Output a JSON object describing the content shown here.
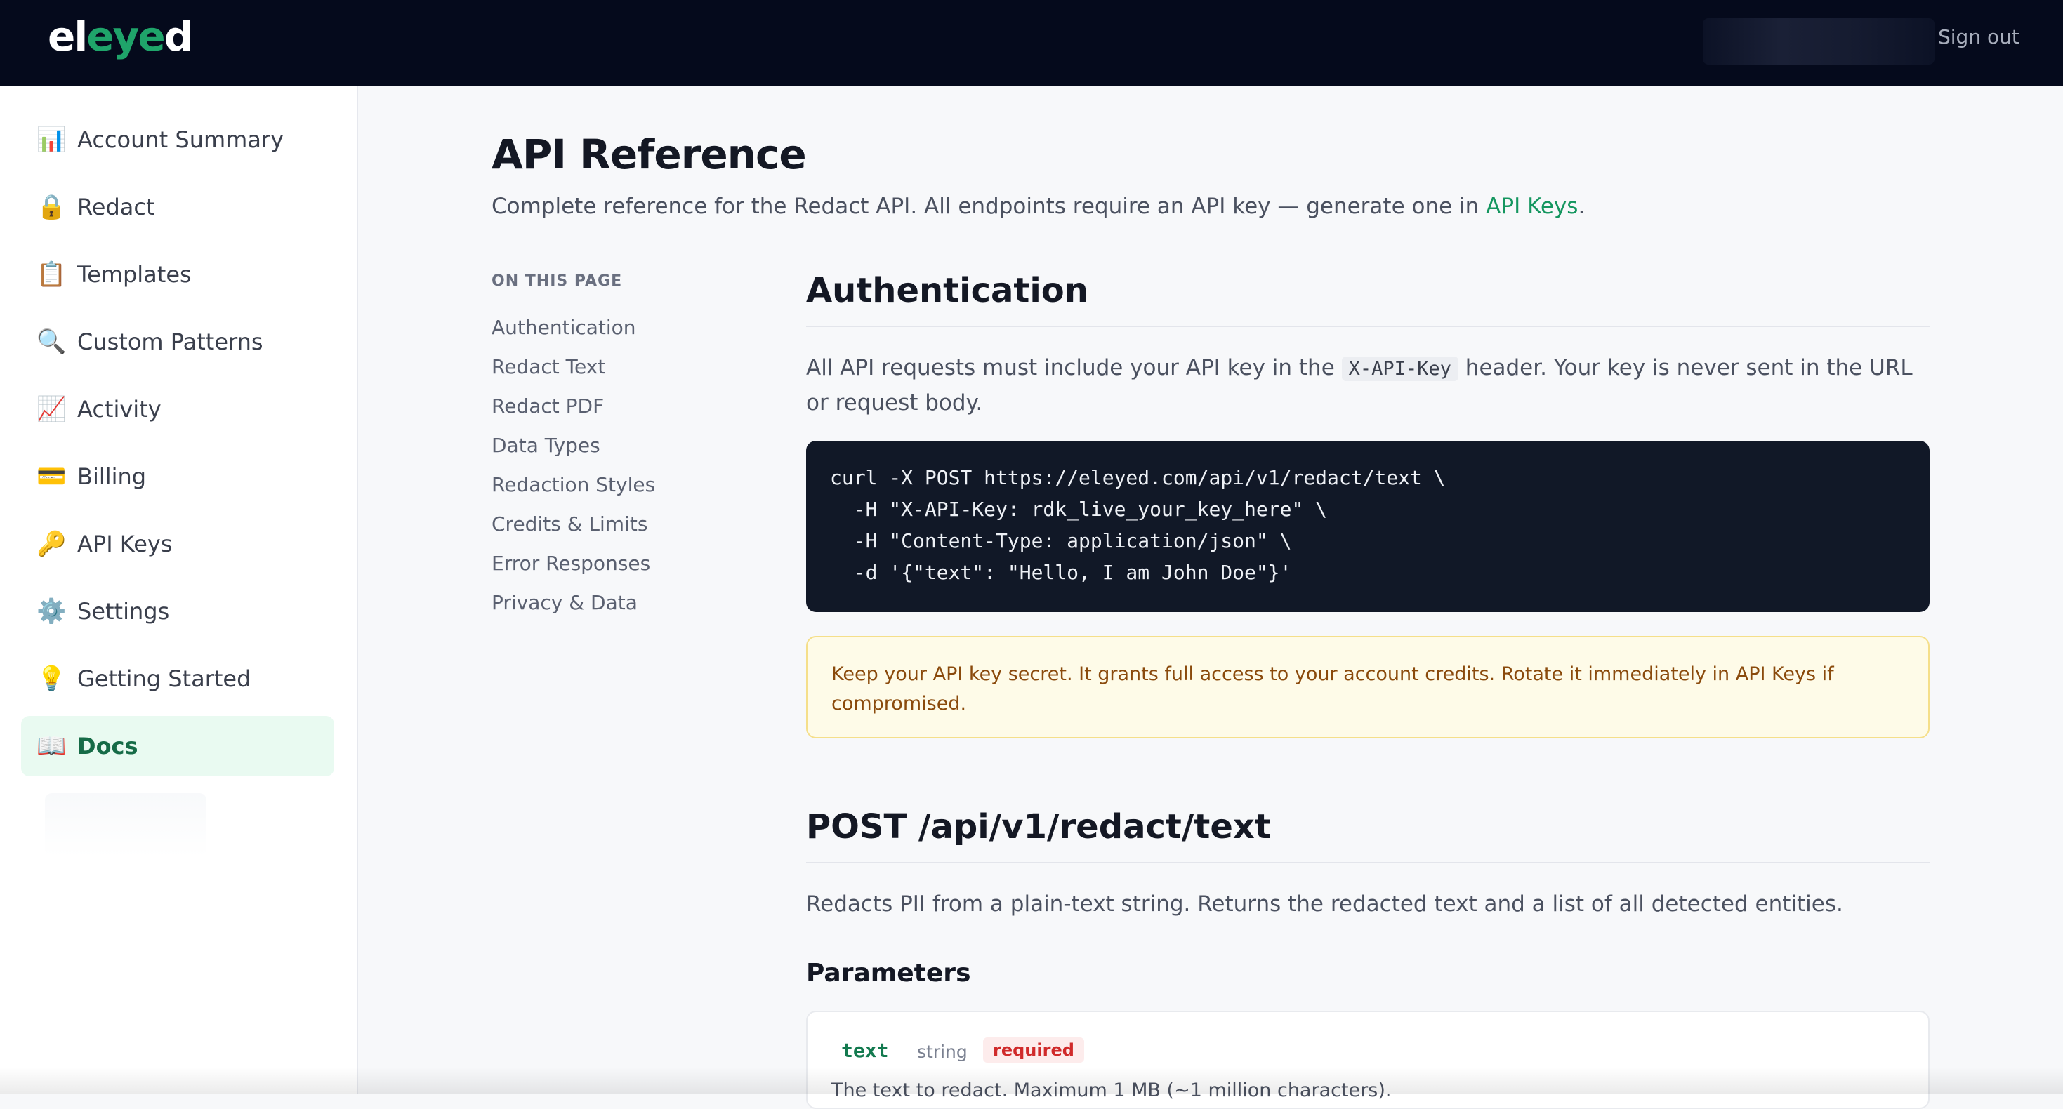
{
  "header": {
    "logo": {
      "part1": "el",
      "part2": "eye",
      "part3": "d"
    },
    "sign_out": "Sign out"
  },
  "sidebar": {
    "items": [
      {
        "icon": "📊",
        "icon_name": "bar-chart-icon",
        "label": "Account Summary"
      },
      {
        "icon": "🔒",
        "icon_name": "lock-icon",
        "label": "Redact"
      },
      {
        "icon": "📋",
        "icon_name": "clipboard-icon",
        "label": "Templates"
      },
      {
        "icon": "🔍",
        "icon_name": "magnifier-icon",
        "label": "Custom Patterns"
      },
      {
        "icon": "📈",
        "icon_name": "trend-chart-icon",
        "label": "Activity"
      },
      {
        "icon": "💳",
        "icon_name": "credit-card-icon",
        "label": "Billing"
      },
      {
        "icon": "🔑",
        "icon_name": "key-icon",
        "label": "API Keys"
      },
      {
        "icon": "⚙️",
        "icon_name": "gear-icon",
        "label": "Settings"
      },
      {
        "icon": "💡",
        "icon_name": "lightbulb-icon",
        "label": "Getting Started"
      },
      {
        "icon": "📖",
        "icon_name": "book-icon",
        "label": "Docs",
        "active": true
      }
    ]
  },
  "page": {
    "title": "API Reference",
    "subtitle": "Complete reference for the Redact API. All endpoints require an API key — generate one in ",
    "subtitle_link": "API Keys",
    "subtitle_end": "."
  },
  "toc": {
    "title": "ON THIS PAGE",
    "items": [
      "Authentication",
      "Redact Text",
      "Redact PDF",
      "Data Types",
      "Redaction Styles",
      "Credits & Limits",
      "Error Responses",
      "Privacy & Data"
    ]
  },
  "auth": {
    "heading": "Authentication",
    "text_before": "All API requests must include your API key in the ",
    "code": "X-API-Key",
    "text_after": " header. Your key is never sent in the URL or request body.",
    "code_lines": [
      "curl -X POST https://eleyed.com/api/v1/redact/text \\",
      "  -H \"X-API-Key: rdk_live_your_key_here\" \\",
      "  -H \"Content-Type: application/json\" \\",
      "  -d '{\"text\": \"Hello, I am John Doe\"}'"
    ],
    "warning": "Keep your API key secret. It grants full access to your account credits. Rotate it immediately in API Keys if compromised."
  },
  "endpoint": {
    "heading": "POST /api/v1/redact/text",
    "description": "Redacts PII from a plain-text string. Returns the redacted text and a list of all detected entities.",
    "params_heading": "Parameters",
    "params": [
      {
        "name": "text",
        "type": "string",
        "required": "required",
        "description": "The text to redact. Maximum 1 MB (~1 million characters)."
      }
    ]
  },
  "colors": {
    "accent": "#14965f",
    "topbar": "#050a1c",
    "code_bg": "#111827",
    "warning_bg": "#fefbe8"
  }
}
